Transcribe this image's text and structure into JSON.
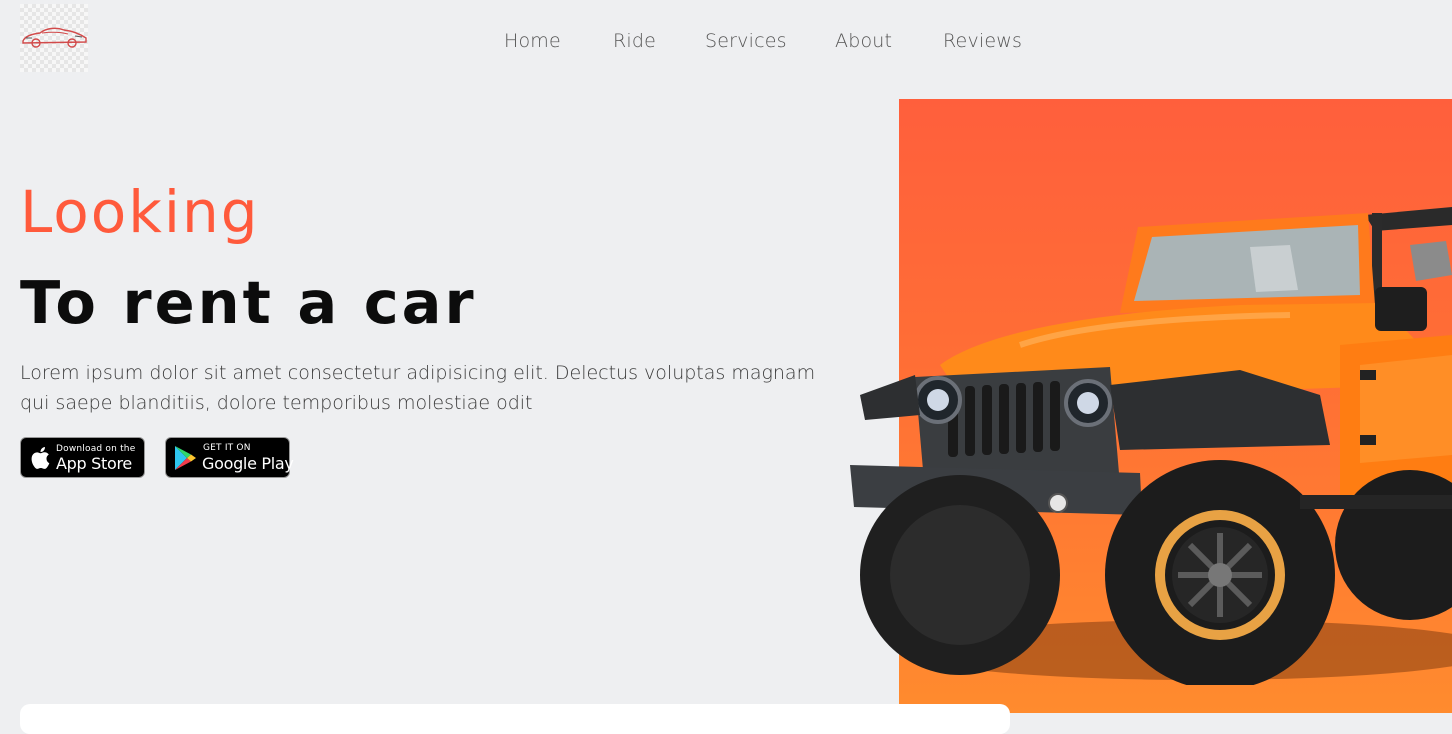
{
  "nav": {
    "items": [
      {
        "label": "Home"
      },
      {
        "label": "Ride"
      },
      {
        "label": "Services"
      },
      {
        "label": "About"
      },
      {
        "label": "Reviews"
      }
    ]
  },
  "hero": {
    "title_accent": "Looking",
    "title_main": "To rent a car",
    "description": "Lorem ipsum dolor sit amet consectetur adipisicing elit. Delectus voluptas magnam qui saepe blanditiis, dolore temporibus molestiae odit",
    "app_store": {
      "small": "Download on the",
      "big": "App Store",
      "icon": "apple-icon"
    },
    "google_play": {
      "small": "GET IT ON",
      "big": "Google Play",
      "icon": "google-play-icon"
    },
    "image": "orange-jeep-image"
  },
  "colors": {
    "accent": "#ff5a3c",
    "hero_panel": "#ff6a37",
    "background": "#eeeff1",
    "text_dark": "#0c0c0c"
  }
}
